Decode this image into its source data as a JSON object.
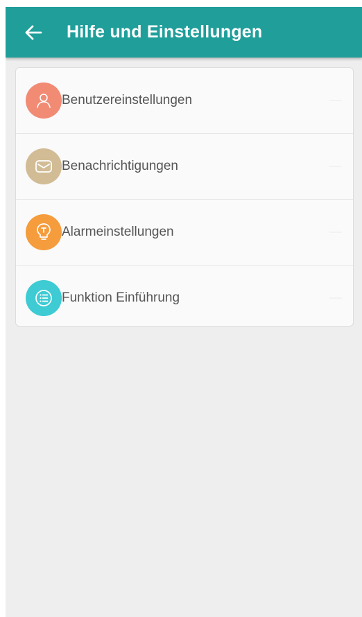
{
  "header": {
    "title": "Hilfe und Einstellungen",
    "back_icon": "arrow-left-icon",
    "background": "#1f9e9a"
  },
  "menu": {
    "items": [
      {
        "label": "Benutzereinstellungen",
        "icon": "person-icon",
        "color": "#f28b74"
      },
      {
        "label": "Benachrichtigungen",
        "icon": "envelope-icon",
        "color": "#d1bc95"
      },
      {
        "label": "Alarmeinstellungen",
        "icon": "lightbulb-icon",
        "color": "#f59c3d"
      },
      {
        "label": "Funktion Einführung",
        "icon": "list-icon",
        "color": "#3ecbd3"
      }
    ]
  }
}
